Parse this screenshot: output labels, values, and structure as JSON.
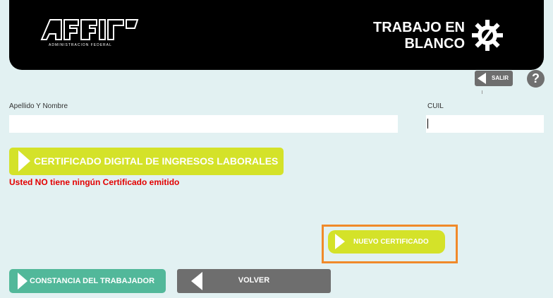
{
  "header": {
    "logo_text": "AFIP",
    "logo_subtitle": "ADMINISTRACION FEDERAL",
    "program_title_line1": "TRABAJO EN",
    "program_title_line2": "BLANCO"
  },
  "toolbar": {
    "salir_label": "SALIR",
    "help_label": "?"
  },
  "form": {
    "name_label": "Apellido Y Nombre",
    "name_value": "",
    "cuil_label": "CUIL",
    "cuil_value": ""
  },
  "certificate": {
    "button_label": "CERTIFICADO DIGITAL DE INGRESOS LABORALES",
    "message": "Usted NO tiene ningún Certificado emitido",
    "new_button_label": "NUEVO CERTIFICADO"
  },
  "footer": {
    "constancia_label": "CONSTANCIA DEL TRABAJADOR",
    "volver_label": "VOLVER"
  },
  "colors": {
    "background": "#e2f1f2",
    "header": "#000000",
    "lime": "#d4e229",
    "teal": "#52b89a",
    "gray": "#6e6e6e",
    "error": "#e30000",
    "highlight": "#f08a2a"
  },
  "icons": [
    "afip-logo",
    "gear-wrench-icon",
    "salir-arrow-icon",
    "help-icon",
    "play-arrow-icon",
    "back-arrow-icon"
  ]
}
